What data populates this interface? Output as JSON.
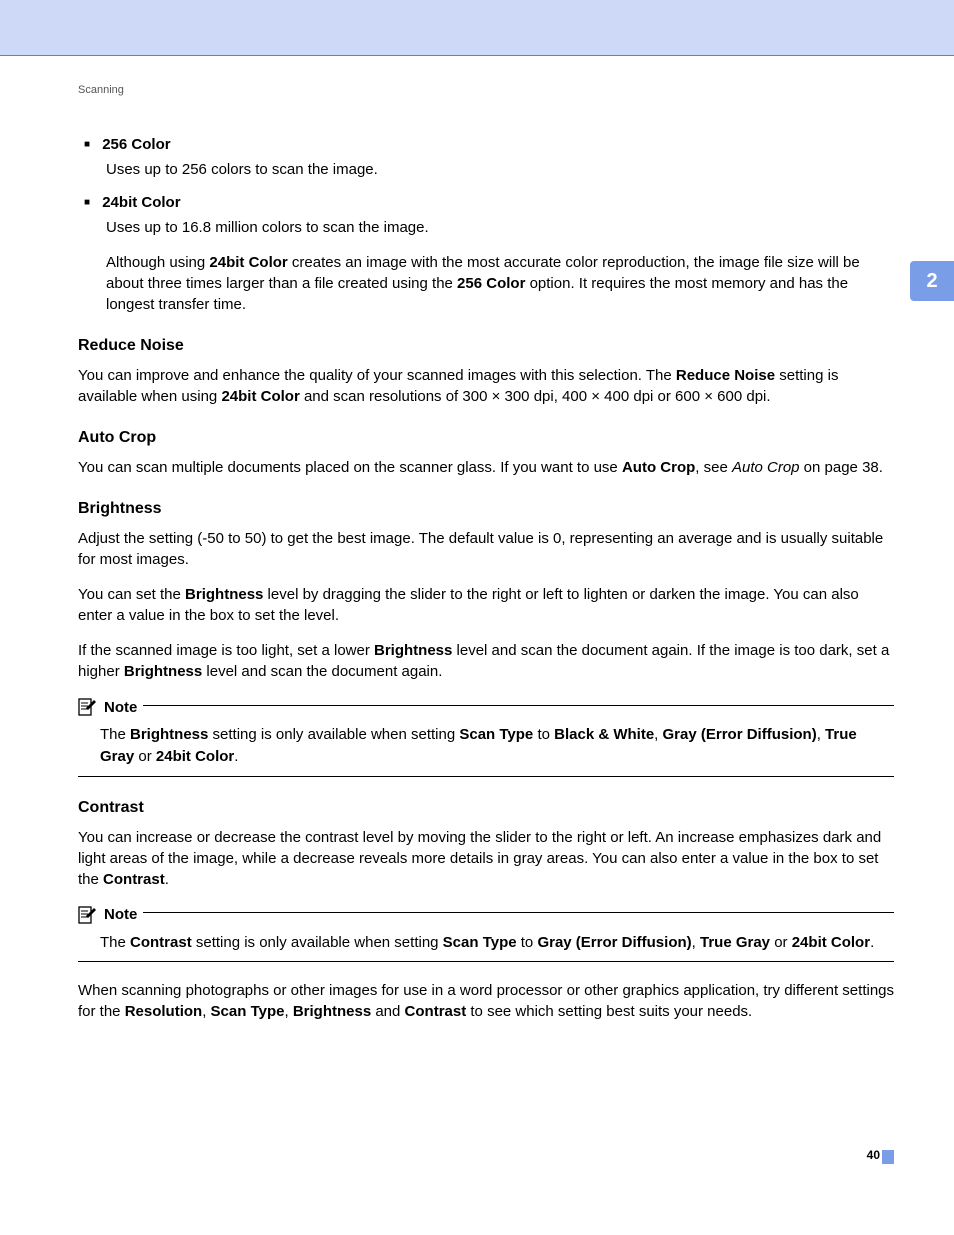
{
  "sectionLabel": "Scanning",
  "chapterNumber": "2",
  "pageNumber": "40",
  "bullets": [
    {
      "title": "256 Color",
      "body": "Uses up to 256 colors to scan the image."
    },
    {
      "title": "24bit Color",
      "body": "Uses up to 16.8 million colors to scan the image.",
      "extraHtml": "Although using <b>24bit Color</b> creates an image with the most accurate color reproduction, the image file size will be about three times larger than a file created using the <b>256 Color</b> option. It requires the most memory and has the longest transfer time."
    }
  ],
  "sections": {
    "reduceNoise": {
      "heading": "Reduce Noise",
      "bodyHtml": "You can improve and enhance the quality of your scanned images with this selection. The <b>Reduce Noise</b> setting is available when using <b>24bit Color</b> and scan resolutions of 300 × 300 dpi, 400 × 400 dpi or 600 × 600 dpi."
    },
    "autoCrop": {
      "heading": "Auto Crop",
      "bodyHtml": "You can scan multiple documents placed on the scanner glass. If you want to use <b>Auto Crop</b>, see <i>Auto Crop</i> on page 38."
    },
    "brightness": {
      "heading": "Brightness",
      "p1": "Adjust the setting (-50 to 50) to get the best image. The default value is 0, representing an average and is usually suitable for most images.",
      "p2Html": "You can set the <b>Brightness</b> level by dragging the slider to the right or left to lighten or darken the image. You can also enter a value in the box to set the level.",
      "p3Html": "If the scanned image is too light, set a lower <b>Brightness</b> level and scan the document again. If the image is too dark, set a higher <b>Brightness</b> level and scan the document again."
    },
    "contrast": {
      "heading": "Contrast",
      "bodyHtml": "You can increase or decrease the contrast level by moving the slider to the right or left. An increase emphasizes dark and light areas of the image, while a decrease reveals more details in gray areas. You can also enter a value in the box to set the <b>Contrast</b>."
    },
    "closingHtml": "When scanning photographs or other images for use in a word processor or other graphics application, try different settings for the <b>Resolution</b>, <b>Scan Type</b>, <b>Brightness</b> and <b>Contrast</b> to see which setting best suits your needs."
  },
  "notes": {
    "label": "Note",
    "brightnessHtml": "The <b>Brightness</b> setting is only available when setting <b>Scan Type</b> to <b>Black & White</b>, <b>Gray (Error Diffusion)</b>, <b>True Gray</b> or <b>24bit Color</b>.",
    "contrastHtml": "The <b>Contrast</b> setting is only available when setting <b>Scan Type</b> to <b>Gray (Error Diffusion)</b>, <b>True Gray</b> or <b>24bit Color</b>."
  }
}
